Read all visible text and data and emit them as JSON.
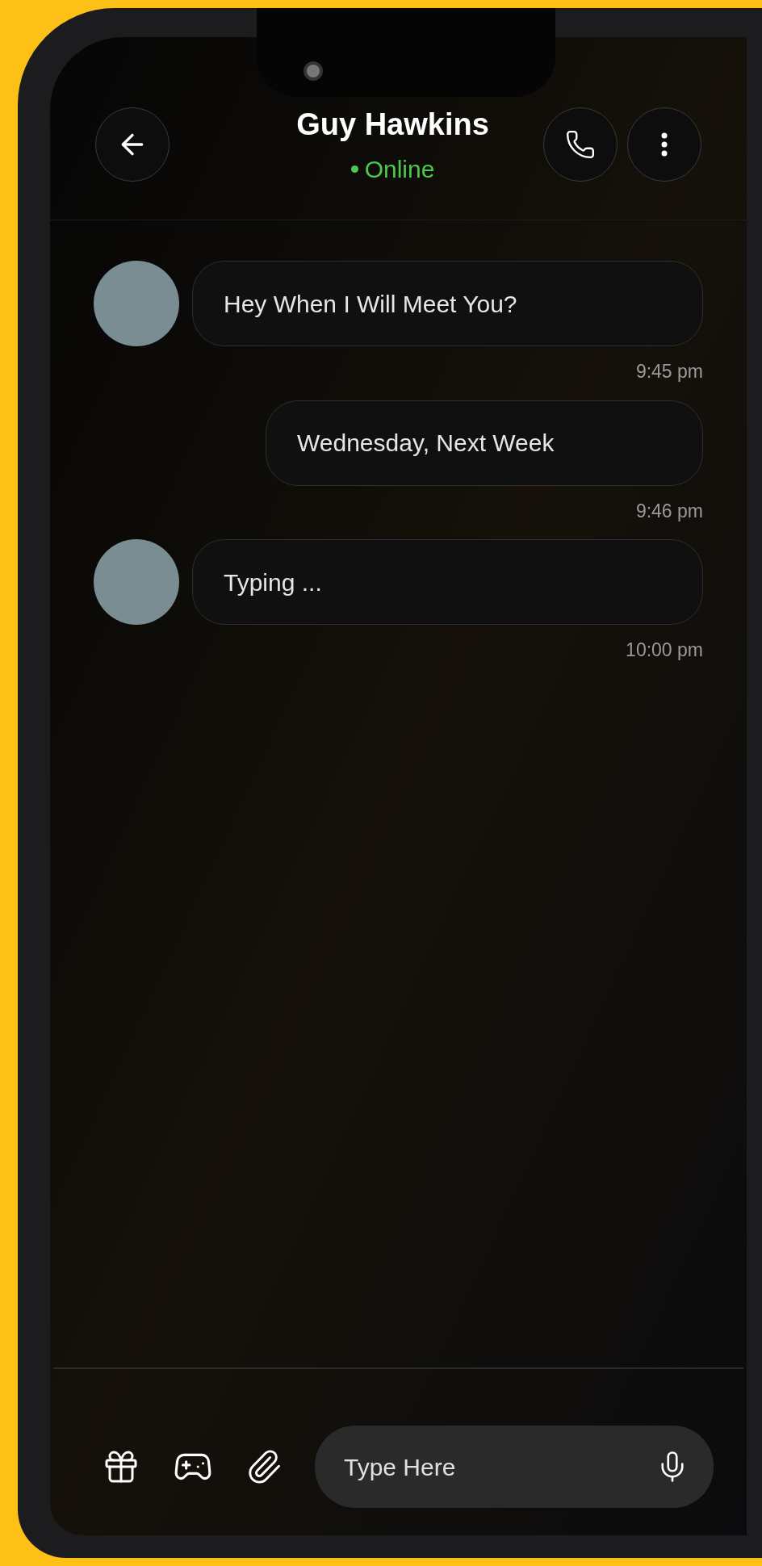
{
  "header": {
    "name": "Guy Hawkins",
    "status": "Online",
    "online": true
  },
  "messages": [
    {
      "kind": "incoming",
      "text": "Hey When I Will Meet You?",
      "time": "9:45 pm"
    },
    {
      "kind": "outgoing",
      "text": "Wednesday, Next Week",
      "time": "9:46 pm"
    },
    {
      "kind": "incoming",
      "text": "Typing ...",
      "time": "10:00 pm"
    }
  ],
  "composer": {
    "placeholder": "Type Here"
  }
}
